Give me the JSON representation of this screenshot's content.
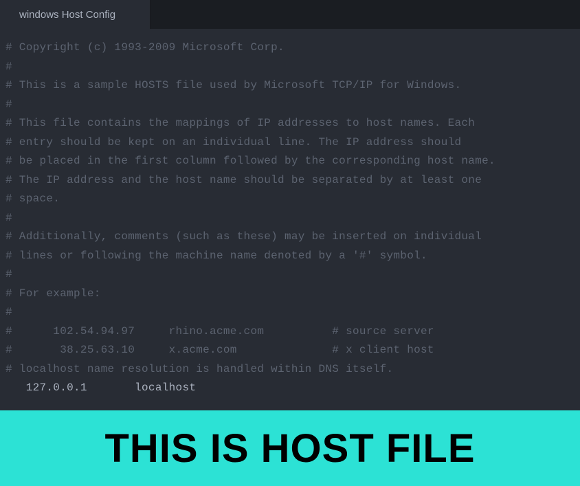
{
  "tab": {
    "label": "windows Host Config"
  },
  "code": {
    "lines": [
      "# Copyright (c) 1993-2009 Microsoft Corp.",
      "#",
      "# This is a sample HOSTS file used by Microsoft TCP/IP for Windows.",
      "#",
      "# This file contains the mappings of IP addresses to host names. Each",
      "# entry should be kept on an individual line. The IP address should",
      "# be placed in the first column followed by the corresponding host name.",
      "# The IP address and the host name should be separated by at least one",
      "# space.",
      "#",
      "# Additionally, comments (such as these) may be inserted on individual",
      "# lines or following the machine name denoted by a '#' symbol.",
      "#",
      "# For example:",
      "#",
      "#      102.54.94.97     rhino.acme.com          # source server",
      "#       38.25.63.10     x.acme.com              # x client host",
      "",
      "# localhost name resolution is handled within DNS itself.",
      "   127.0.0.1       localhost"
    ]
  },
  "banner": {
    "text": "THIS IS HOST FILE"
  }
}
